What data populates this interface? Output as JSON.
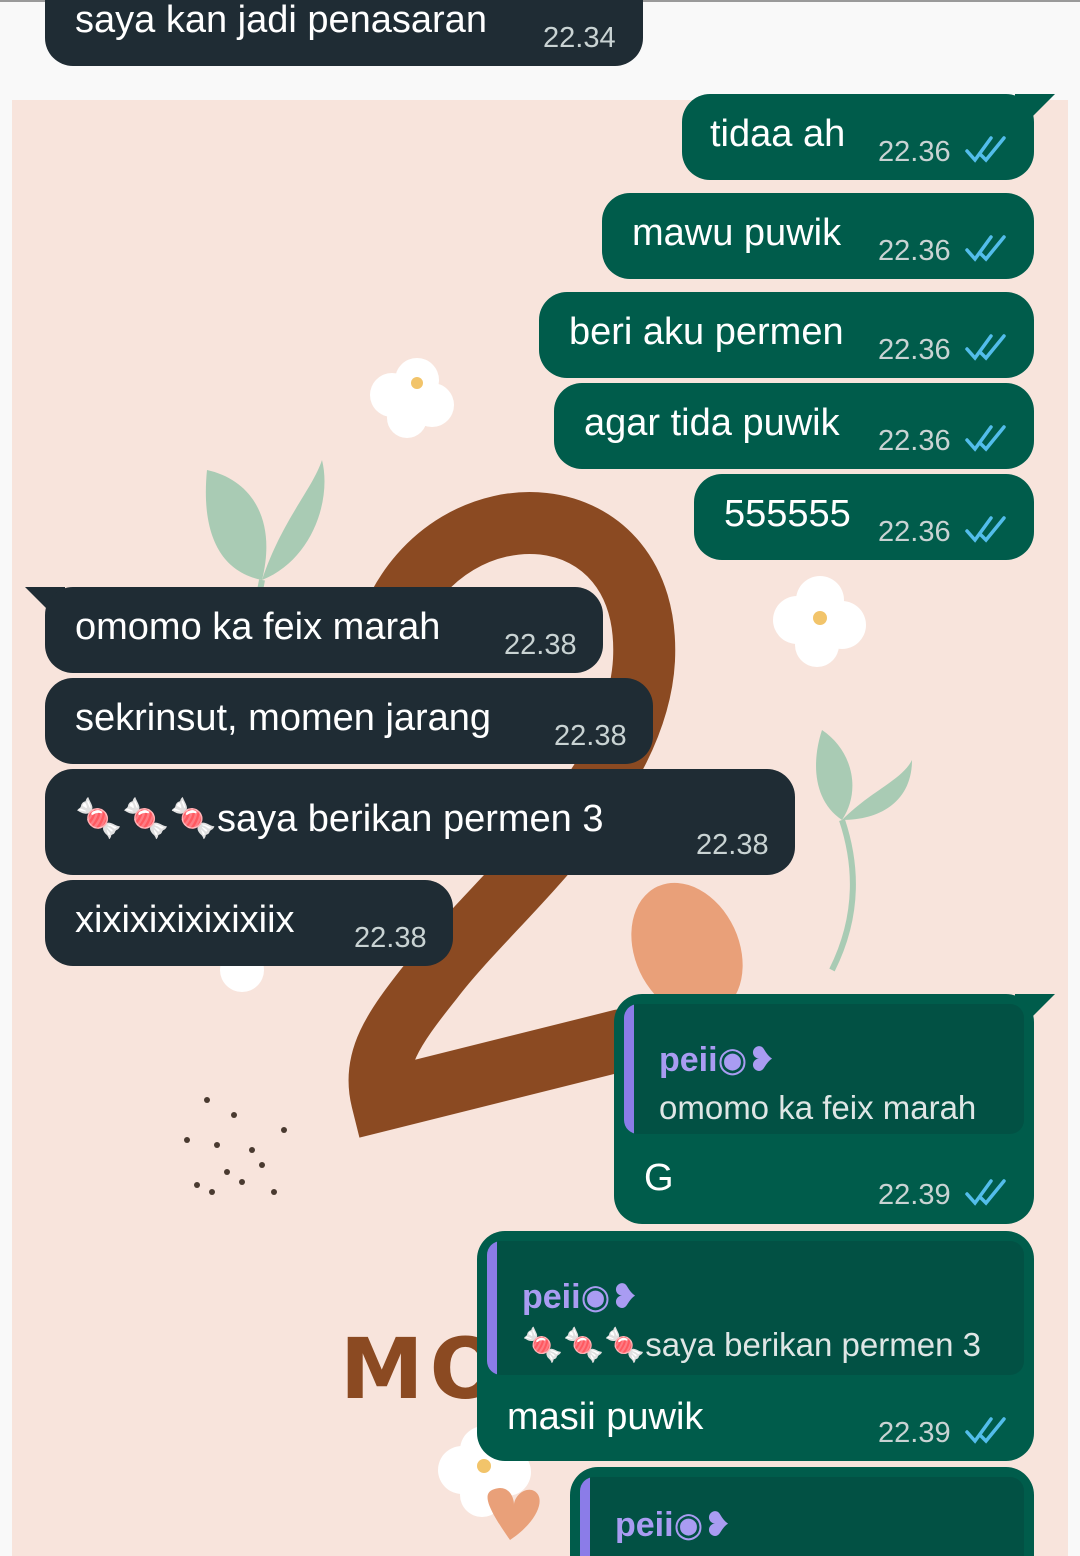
{
  "colors": {
    "incoming_bubble": "#1f2c34",
    "outgoing_bubble": "#005c4b",
    "quote_bar": "#8b7ce8",
    "read_ticks": "#53bdeb",
    "wallpaper": "#f8e4dc"
  },
  "wallpaper": {
    "text": "MO"
  },
  "messages": [
    {
      "direction": "incoming",
      "text": "saya kan jadi penasaran",
      "time": "22.34"
    },
    {
      "direction": "outgoing",
      "text": "tidaa ah",
      "time": "22.36",
      "status": "read"
    },
    {
      "direction": "outgoing",
      "text": "mawu puwik",
      "time": "22.36",
      "status": "read"
    },
    {
      "direction": "outgoing",
      "text": "beri aku permen",
      "time": "22.36",
      "status": "read"
    },
    {
      "direction": "outgoing",
      "text": "agar tida puwik",
      "time": "22.36",
      "status": "read"
    },
    {
      "direction": "outgoing",
      "text": "555555",
      "time": "22.36",
      "status": "read"
    },
    {
      "direction": "incoming",
      "text": "omomo ka feix marah",
      "time": "22.38"
    },
    {
      "direction": "incoming",
      "text": "sekrinsut, momen jarang",
      "time": "22.38"
    },
    {
      "direction": "incoming",
      "text": "🍬🍬🍬saya berikan permen 3",
      "time": "22.38"
    },
    {
      "direction": "incoming",
      "text": "xixixixixixixiix",
      "time": "22.38"
    },
    {
      "direction": "outgoing",
      "reply_to": {
        "author": "peii◉❥",
        "text": "omomo ka feix marah"
      },
      "text": "G",
      "time": "22.39",
      "status": "read"
    },
    {
      "direction": "outgoing",
      "reply_to": {
        "author": "peii◉❥",
        "text": "🍬🍬🍬saya berikan permen 3"
      },
      "text": "masii puwik",
      "time": "22.39",
      "status": "read"
    },
    {
      "direction": "outgoing",
      "reply_to": {
        "author": "peii◉❥",
        "text": ""
      },
      "text": "",
      "time": "",
      "status": ""
    }
  ]
}
